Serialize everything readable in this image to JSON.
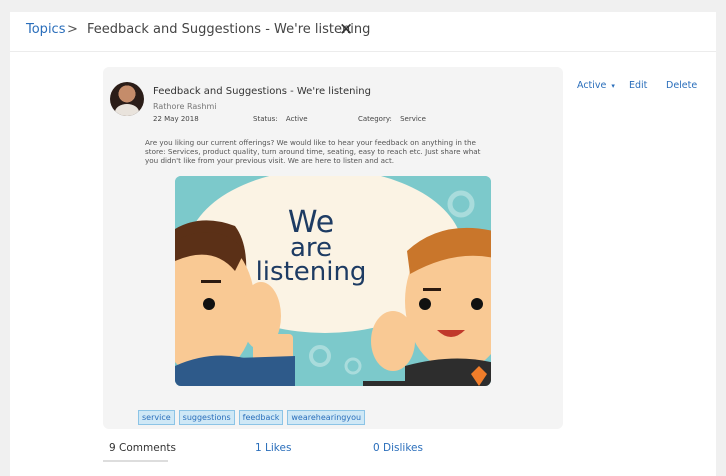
{
  "breadcrumb": {
    "root": "Topics",
    "separator": ">",
    "current": "Feedback and Suggestions - We're listening",
    "close_icon": "close-icon"
  },
  "post": {
    "title": "Feedback and Suggestions - We're listening",
    "author": "Rathore Rashmi",
    "date": "22 May 2018",
    "status_label": "Status:",
    "status_value": "Active",
    "category_label": "Category:",
    "category_value": "Service",
    "description": "Are you liking our current offerings? We would like to hear your feedback on anything in the store: Services, product quality, turn around time, seating, easy to reach etc. Just share what you didn't like from your previous visit. We are here to listen and act.",
    "banner_text": [
      "We",
      "are",
      "listening"
    ],
    "tags": [
      "service",
      "suggestions",
      "feedback",
      "wearehearingyou"
    ]
  },
  "actions": {
    "active": "Active",
    "edit": "Edit",
    "delete": "Delete"
  },
  "stats": {
    "comments": "9 Comments",
    "likes": "1 Likes",
    "dislikes": "0 Dislikes"
  },
  "colors": {
    "link": "#2a6ebb",
    "banner_bg": "#7cc9cb",
    "banner_text": "#1d3b63"
  }
}
